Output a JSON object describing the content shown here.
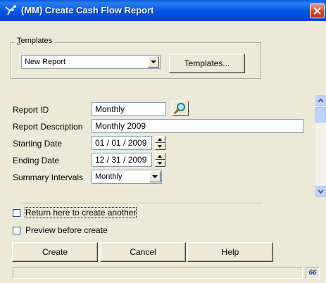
{
  "window": {
    "title": "(MM) Create Cash Flow Report"
  },
  "templates": {
    "group_label_prefix": "",
    "group_label_underlined": "T",
    "group_label_rest": "emplates",
    "selected": "New Report",
    "button_label": "Templates..."
  },
  "form": {
    "report_id": {
      "label": "Report ID",
      "value": "Monthly"
    },
    "report_description": {
      "label": "Report Description",
      "value": "Monthly 2009"
    },
    "starting_date": {
      "label": "Starting Date",
      "value": "01 / 01 / 2009"
    },
    "ending_date": {
      "label": "Ending Date",
      "value": "12 / 31 / 2009"
    },
    "summary_intervals": {
      "label": "Summary Intervals",
      "value": "Monthly"
    }
  },
  "options": {
    "return_here": {
      "label": "Return here to create another",
      "checked": false
    },
    "preview": {
      "label": "Preview before create",
      "checked": false
    }
  },
  "buttons": {
    "create": "Create",
    "cancel": "Cancel",
    "help": "Help"
  },
  "status": {
    "icon": "binoculars-icon",
    "glyph": "66"
  },
  "colors": {
    "titlebar": "#0054e3",
    "close": "#d9442b",
    "face": "#ece9d8"
  }
}
